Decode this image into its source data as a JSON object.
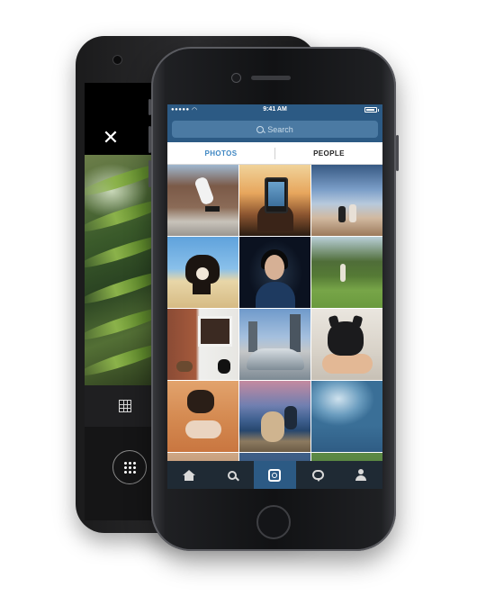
{
  "back_device": {
    "close_icon": "close-icon",
    "grid_icon": "grid-icon",
    "app_drawer_icon": "app-drawer-icon"
  },
  "status_bar": {
    "signal": "●●●●●",
    "wifi": "wifi-icon",
    "time": "9:41 AM",
    "battery_level": 0.85
  },
  "search": {
    "placeholder": "Search"
  },
  "tabs": [
    {
      "label": "PHOTOS",
      "active": true
    },
    {
      "label": "PEOPLE",
      "active": false
    }
  ],
  "grid": {
    "columns": 3,
    "photo_count": 15
  },
  "bottom_nav": [
    {
      "icon": "home-icon",
      "active": false
    },
    {
      "icon": "search-icon",
      "active": false
    },
    {
      "icon": "camera-icon",
      "active": true
    },
    {
      "icon": "activity-icon",
      "active": false
    },
    {
      "icon": "profile-icon",
      "active": false
    }
  ],
  "colors": {
    "header_blue": "#2c5a84",
    "tab_active": "#3f87c3",
    "nav_bg": "#1f2a34"
  }
}
